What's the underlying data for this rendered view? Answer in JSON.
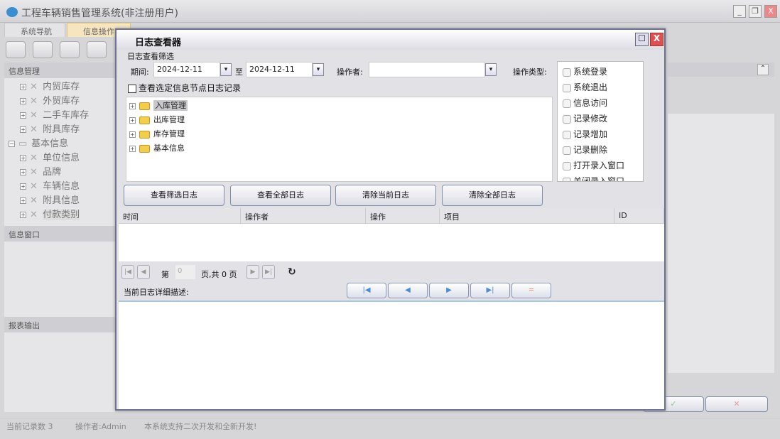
{
  "app": {
    "title": "工程车辆销售管理系统(非注册用户)",
    "minimize": "_",
    "restore": "❐",
    "close": "X"
  },
  "tabs": [
    {
      "label": "系统导航"
    },
    {
      "label": "信息操作"
    }
  ],
  "sidebar": {
    "sections": [
      {
        "title": "信息管理"
      },
      {
        "title": "信息窗口"
      },
      {
        "title": "报表输出"
      }
    ],
    "items": [
      {
        "label": "内贸库存"
      },
      {
        "label": "外贸库存"
      },
      {
        "label": "二手车库存"
      },
      {
        "label": "附具库存"
      },
      {
        "label": "基本信息",
        "folder": true
      },
      {
        "label": "单位信息"
      },
      {
        "label": "品牌"
      },
      {
        "label": "车辆信息"
      },
      {
        "label": "附具信息"
      },
      {
        "label": "付款类别"
      }
    ]
  },
  "right": {
    "collapse": "⌃",
    "confirm": "✓",
    "cancel": "✕"
  },
  "status": {
    "records": "当前记录数 3",
    "operator": "操作者:Admin",
    "message": "本系统支持二次开发和全新开发!"
  },
  "dialog": {
    "title": "日志查看器",
    "maximize": "☐",
    "close": "X",
    "filter": {
      "group": "日志查看筛选",
      "period_label": "期间:",
      "from": "2024-12-11",
      "to_label": "至",
      "to": "2024-12-11",
      "operator_label": "操作者:",
      "operator_value": "",
      "type_label": "操作类型:",
      "node_checkbox": "查看选定信息节点日志记录"
    },
    "types": [
      {
        "label": "系统登录"
      },
      {
        "label": "系统退出"
      },
      {
        "label": "信息访问"
      },
      {
        "label": "记录修改"
      },
      {
        "label": "记录增加"
      },
      {
        "label": "记录删除"
      },
      {
        "label": "打开录入窗口"
      },
      {
        "label": "关闭录入窗口"
      }
    ],
    "tree": [
      {
        "label": "入库管理",
        "selected": true
      },
      {
        "label": "出库管理"
      },
      {
        "label": "库存管理"
      },
      {
        "label": "基本信息"
      }
    ],
    "buttons": [
      {
        "label": "查看筛选日志"
      },
      {
        "label": "查看全部日志"
      },
      {
        "label": "清除当前日志"
      },
      {
        "label": "清除全部日志"
      }
    ],
    "columns": [
      "时间",
      "操作者",
      "操作",
      "项目",
      "ID"
    ],
    "pager": {
      "page_prefix": "第",
      "page": "0",
      "page_suffix": "页,共 0 页"
    },
    "detail_label": "当前日志详细描述:",
    "nav": [
      "|◀",
      "◀",
      "▶",
      "▶|",
      "═"
    ]
  }
}
